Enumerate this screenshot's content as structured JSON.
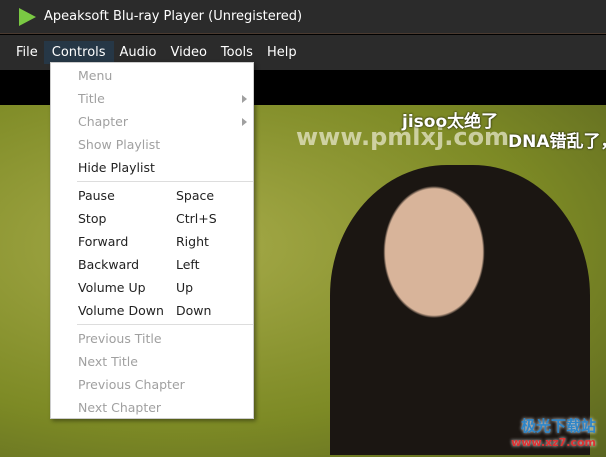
{
  "window": {
    "title": "Apeaksoft Blu-ray Player (Unregistered)"
  },
  "menubar": [
    "File",
    "Controls",
    "Audio",
    "Video",
    "Tools",
    "Help"
  ],
  "controls_menu": {
    "group1": [
      {
        "label": "Menu",
        "disabled": true
      },
      {
        "label": "Title",
        "disabled": true,
        "submenu": true
      },
      {
        "label": "Chapter",
        "disabled": true,
        "submenu": true
      },
      {
        "label": "Show Playlist",
        "disabled": true
      },
      {
        "label": "Hide Playlist",
        "disabled": false
      }
    ],
    "group2": [
      {
        "label": "Pause",
        "shortcut": "Space"
      },
      {
        "label": "Stop",
        "shortcut": "Ctrl+S"
      },
      {
        "label": "Forward",
        "shortcut": "Right"
      },
      {
        "label": "Backward",
        "shortcut": "Left"
      },
      {
        "label": "Volume Up",
        "shortcut": "Up"
      },
      {
        "label": "Volume Down",
        "shortcut": "Down"
      }
    ],
    "group3": [
      {
        "label": "Previous Title"
      },
      {
        "label": "Next Title"
      },
      {
        "label": "Previous Chapter"
      },
      {
        "label": "Next Chapter"
      }
    ]
  },
  "video": {
    "subtitle1": "jisoo太绝了",
    "subtitle2": "DNA错乱了，",
    "watermark": "www.pmlxj.com",
    "site_watermark": "极光下载站",
    "site_url": "www.xz7.com"
  }
}
